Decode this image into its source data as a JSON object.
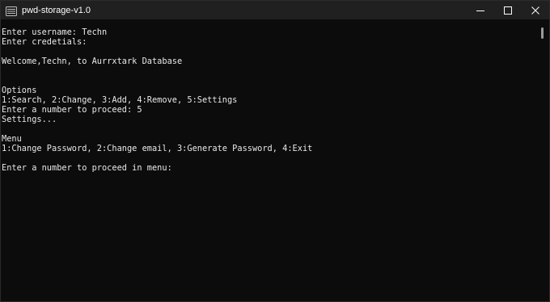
{
  "window": {
    "title": "pwd-storage-v1.0",
    "icons": {
      "app": "terminal-icon",
      "minimize": "minimize-icon",
      "maximize": "maximize-icon",
      "close": "close-icon"
    }
  },
  "console": {
    "lines": [
      "Enter username: Techn",
      "Enter credetials:",
      "",
      "Welcome,Techn, to Aurrxtark Database",
      "",
      "",
      "Options",
      "1:Search, 2:Change, 3:Add, 4:Remove, 5:Settings",
      "Enter a number to proceed: 5",
      "Settings...",
      "",
      "Menu",
      "1:Change Password, 2:Change email, 3:Generate Password, 4:Exit",
      "",
      "Enter a number to proceed in menu:"
    ]
  }
}
